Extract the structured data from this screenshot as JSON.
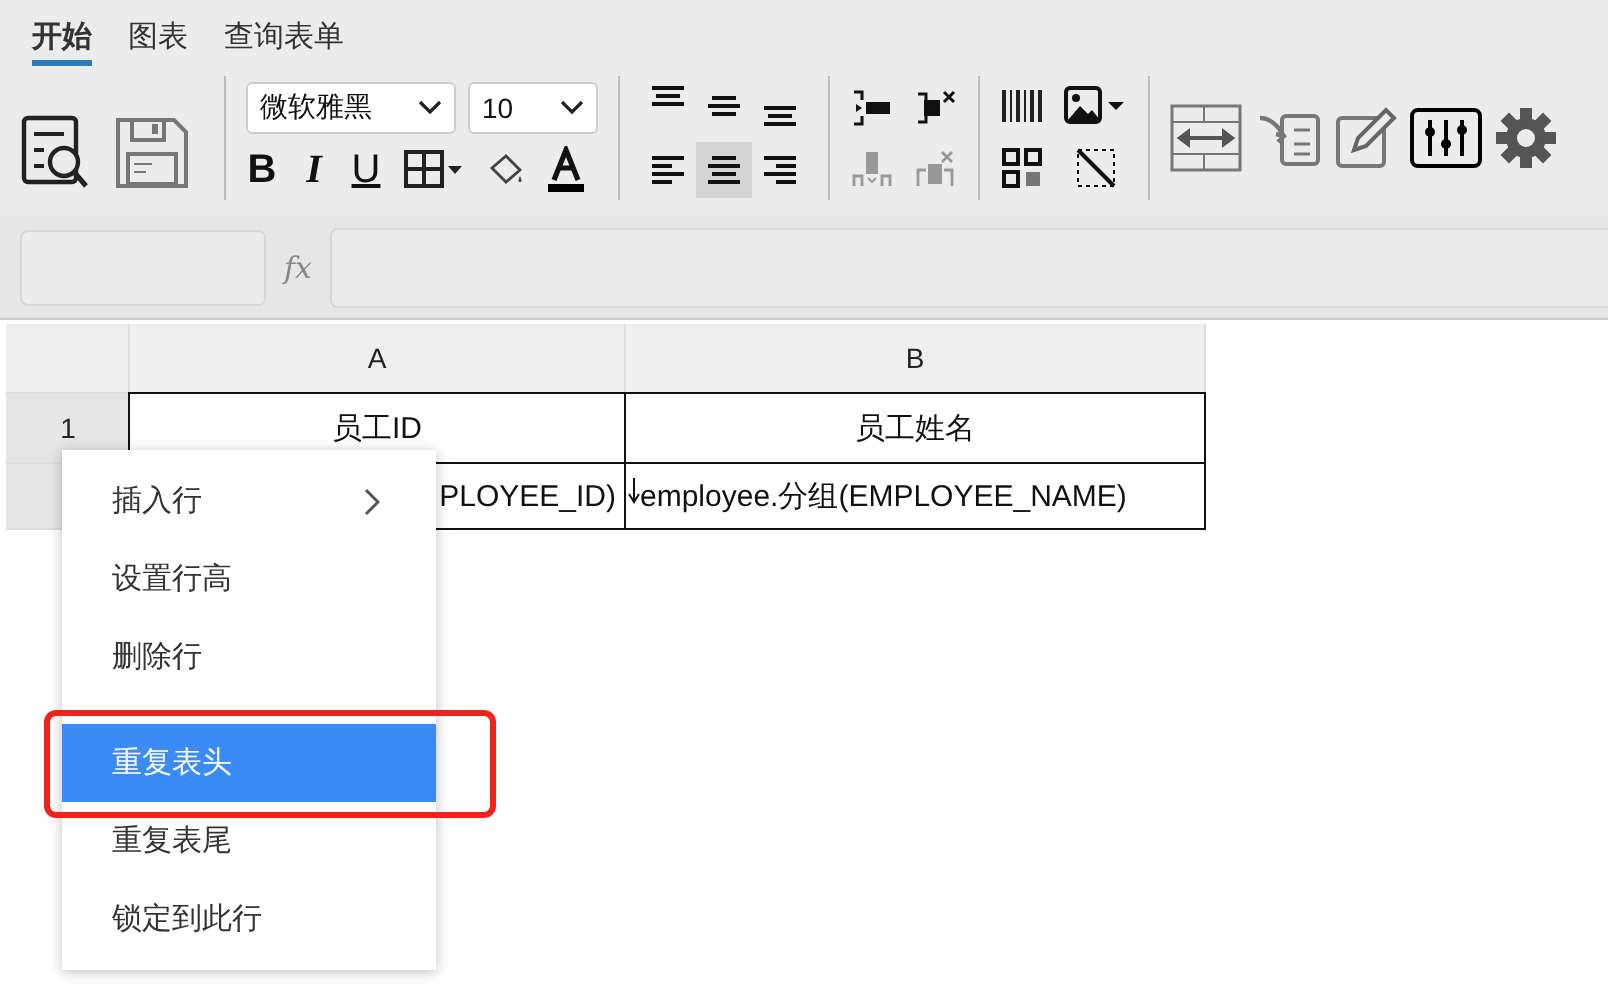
{
  "tabs": [
    {
      "label": "开始",
      "selected": true
    },
    {
      "label": "图表",
      "selected": false
    },
    {
      "label": "查询表单",
      "selected": false
    }
  ],
  "font_family": "微软雅黑",
  "font_size": "10",
  "style_buttons": [
    {
      "kind": "bold",
      "label": "B"
    },
    {
      "kind": "italic",
      "label": "I"
    },
    {
      "kind": "underline",
      "label": "U"
    }
  ],
  "align_buttons": [
    {
      "kind": "top",
      "selected": false
    },
    {
      "kind": "middle",
      "selected": false
    },
    {
      "kind": "bottom",
      "selected": false
    },
    {
      "kind": "left",
      "selected": false
    },
    {
      "kind": "center",
      "selected": true
    },
    {
      "kind": "right",
      "selected": false
    }
  ],
  "formula_bar": {
    "fx": "fx"
  },
  "sheet": {
    "columns": [
      "A",
      "B"
    ],
    "rows": [
      {
        "number": "1",
        "cells": [
          "员工ID",
          "员工姓名"
        ]
      },
      {
        "number": "",
        "cells": [
          "PLOYEE_ID)",
          "employee.分组(EMPLOYEE_NAME)"
        ]
      }
    ]
  },
  "context_menu": {
    "groups": [
      {
        "items": [
          {
            "label": "插入行",
            "submenu": true,
            "selected": false,
            "outlined": false
          },
          {
            "label": "设置行高",
            "submenu": false,
            "selected": false,
            "outlined": false
          },
          {
            "label": "删除行",
            "submenu": false,
            "selected": false,
            "outlined": false
          }
        ]
      },
      {
        "items": [
          {
            "label": "重复表头",
            "submenu": false,
            "selected": true,
            "outlined": true
          },
          {
            "label": "重复表尾",
            "submenu": false,
            "selected": false,
            "outlined": false
          },
          {
            "label": "锁定到此行",
            "submenu": false,
            "selected": false,
            "outlined": false
          }
        ]
      }
    ]
  }
}
